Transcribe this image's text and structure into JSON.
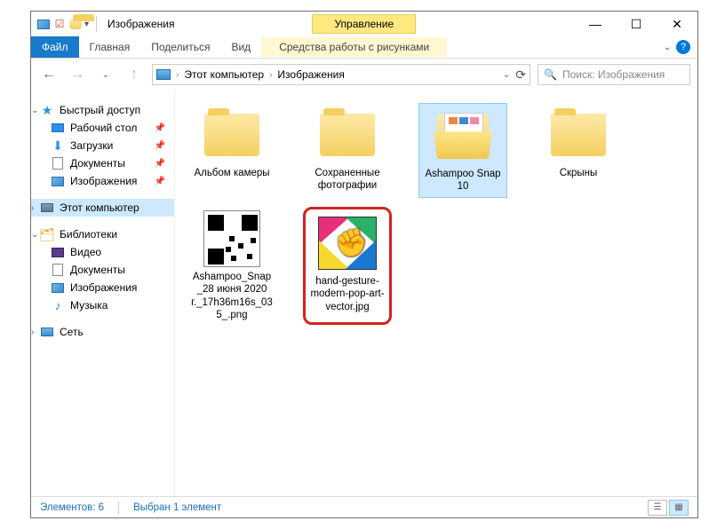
{
  "title": "Изображения",
  "tools_tab": "Управление",
  "ribbon": {
    "file": "Файл",
    "home": "Главная",
    "share": "Поделиться",
    "view": "Вид",
    "tools": "Средства работы с рисунками"
  },
  "address": {
    "root": "Этот компьютер",
    "folder": "Изображения"
  },
  "search_placeholder": "Поиск: Изображения",
  "nav": {
    "quick": {
      "label": "Быстрый доступ",
      "items": [
        {
          "label": "Рабочий стол"
        },
        {
          "label": "Загрузки"
        },
        {
          "label": "Документы"
        },
        {
          "label": "Изображения"
        }
      ]
    },
    "pc": "Этот компьютер",
    "libs": {
      "label": "Библиотеки",
      "items": [
        {
          "label": "Видео"
        },
        {
          "label": "Документы"
        },
        {
          "label": "Изображения"
        },
        {
          "label": "Музыка"
        }
      ]
    },
    "network": "Сеть"
  },
  "items": [
    {
      "label": "Альбом камеры",
      "type": "folder"
    },
    {
      "label": "Сохраненные фотографии",
      "type": "folder"
    },
    {
      "label": "Ashampoo Snap 10",
      "type": "folder-open",
      "selected": true
    },
    {
      "label": "Скрыны",
      "type": "folder"
    },
    {
      "label": "Ashampoo_Snap_28 июня 2020 г._17h36m16s_035_.png",
      "type": "qr"
    },
    {
      "label": "hand-gesture-modern-pop-art-vector.jpg",
      "type": "popart",
      "highlighted": true
    }
  ],
  "status": {
    "count": "Элементов: 6",
    "selected": "Выбран 1 элемент"
  }
}
